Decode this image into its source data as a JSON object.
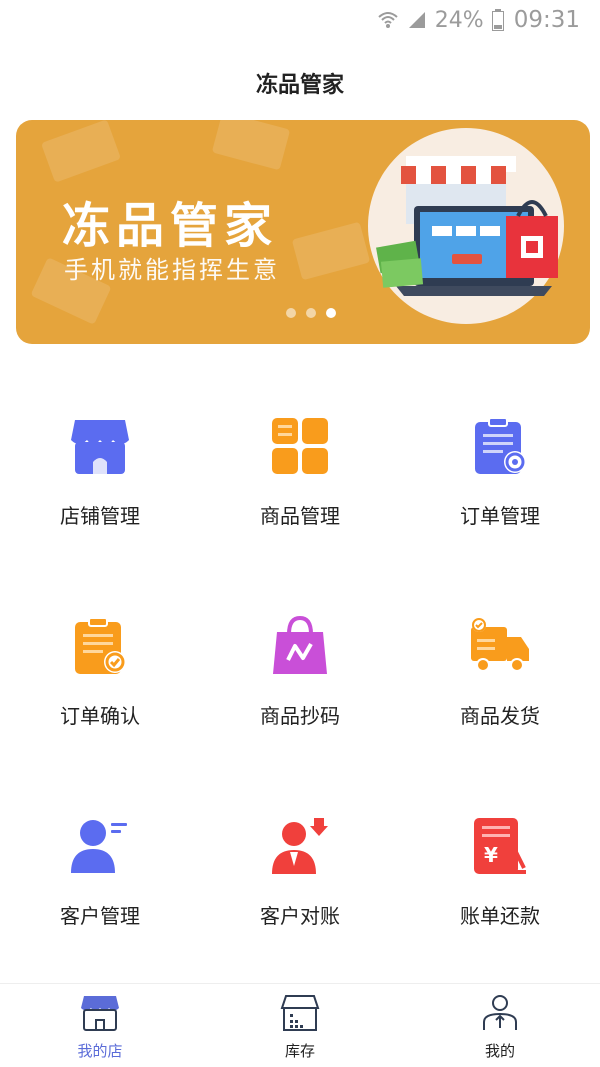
{
  "status_bar": {
    "battery": "24%",
    "time": "09:31"
  },
  "header": {
    "title": "冻品管家"
  },
  "banner": {
    "headline": "冻品管家",
    "subheadline": "手机就能指挥生意",
    "active_dot": 3,
    "dot_count": 3
  },
  "grid": [
    {
      "label": "店铺管理",
      "icon": "store-icon",
      "color": "#5b6cf0"
    },
    {
      "label": "商品管理",
      "icon": "grid-apps-icon",
      "color": "#f99c1c"
    },
    {
      "label": "订单管理",
      "icon": "order-list-icon",
      "color": "#5b6cf0"
    },
    {
      "label": "订单确认",
      "icon": "clipboard-check-icon",
      "color": "#f99c1c"
    },
    {
      "label": "商品抄码",
      "icon": "shopping-bag-icon",
      "color": "#c94fd8"
    },
    {
      "label": "商品发货",
      "icon": "delivery-truck-icon",
      "color": "#f99c1c"
    },
    {
      "label": "客户管理",
      "icon": "customer-icon",
      "color": "#5b6cf0"
    },
    {
      "label": "客户对账",
      "icon": "customer-reconcile-icon",
      "color": "#f0403c"
    },
    {
      "label": "账单还款",
      "icon": "bill-repay-icon",
      "color": "#f0403c"
    }
  ],
  "tabs": [
    {
      "label": "我的店",
      "icon": "store-tab-icon",
      "active": true
    },
    {
      "label": "库存",
      "icon": "inventory-tab-icon",
      "active": false
    },
    {
      "label": "我的",
      "icon": "profile-tab-icon",
      "active": false
    }
  ],
  "colors": {
    "accent": "#5b6cd8",
    "banner": "#e5a43c"
  }
}
